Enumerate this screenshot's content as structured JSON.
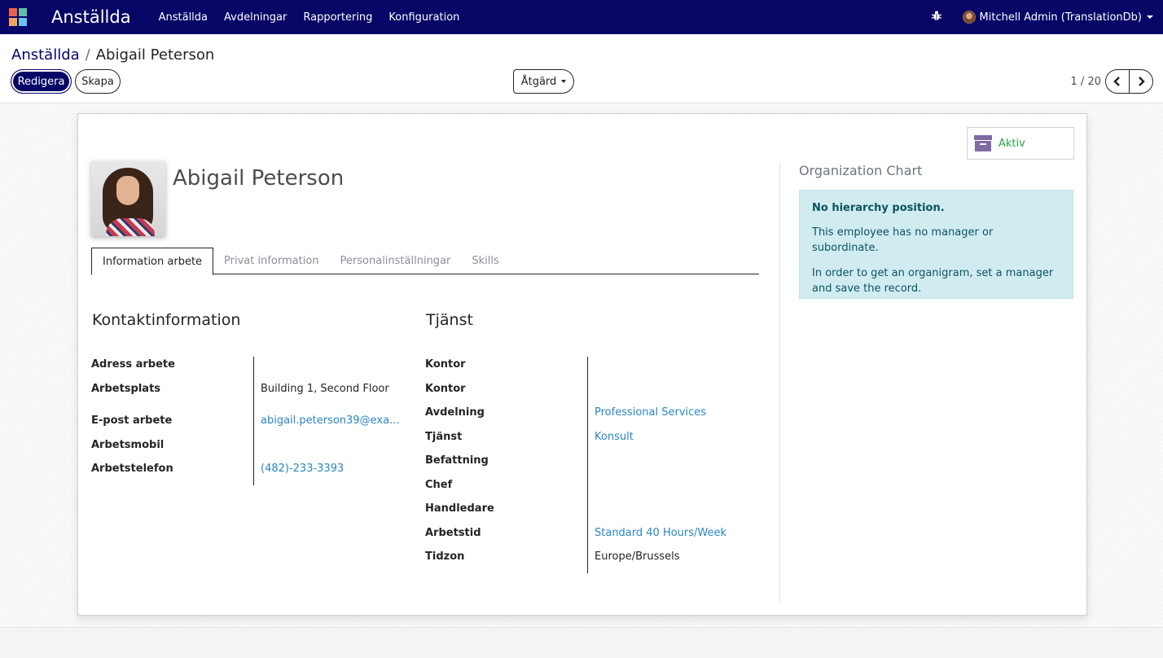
{
  "navbar": {
    "app_title": "Anställda",
    "menu": [
      "Anställda",
      "Avdelningar",
      "Rapportering",
      "Konfiguration"
    ],
    "user": "Mitchell Admin (TranslationDb)",
    "apps_icon_colors": [
      "#f06050",
      "#5bc1a7",
      "#f4a460",
      "#6cc1ed"
    ]
  },
  "breadcrumb": {
    "parent": "Anställda",
    "separator": "/",
    "current": "Abigail Peterson"
  },
  "buttons": {
    "edit": "Redigera",
    "create": "Skapa",
    "action": "Åtgärd"
  },
  "pager": {
    "value": "1 / 20",
    "prev_icon": "chevron-left-icon",
    "next_icon": "chevron-right-icon"
  },
  "archive": {
    "label": "Aktiv",
    "icon": "archive-icon"
  },
  "employee": {
    "name": "Abigail Peterson"
  },
  "tabs": [
    "Information arbete",
    "Privat information",
    "Personalinställningar",
    "Skills"
  ],
  "contact": {
    "title": "Kontaktinformation",
    "fields": [
      {
        "label": "Adress arbete",
        "value": ""
      },
      {
        "label": "Arbetsplats",
        "value": "Building 1, Second Floor"
      },
      {
        "label": "E-post arbete",
        "value": "abigail.peterson39@exa…"
      },
      {
        "label": "Arbetsmobil",
        "value": ""
      },
      {
        "label": "Arbetstelefon",
        "value": "(482)-233-3393"
      }
    ]
  },
  "position": {
    "title": "Tjänst",
    "fields": [
      {
        "label": "Kontor",
        "value": ""
      },
      {
        "label": "Kontor",
        "value": ""
      },
      {
        "label": "Avdelning",
        "value": "Professional Services"
      },
      {
        "label": "Tjänst",
        "value": "Konsult"
      },
      {
        "label": "Befattning",
        "value": ""
      },
      {
        "label": "Chef",
        "value": ""
      },
      {
        "label": "Handledare",
        "value": ""
      },
      {
        "label": "Arbetstid",
        "value": "Standard 40 Hours/Week"
      },
      {
        "label": "Tidzon",
        "value": "Europe/Brussels"
      }
    ]
  },
  "org_chart": {
    "title": "Organization Chart",
    "heading": "No hierarchy position.",
    "line1": "This employee has no manager or subordinate.",
    "line2": "In order to get an organigram, set a manager and save the record."
  },
  "colors": {
    "brand": "#070566",
    "link": "#2a86c4",
    "active": "#28a745",
    "alert_bg": "#d1ecf1"
  }
}
